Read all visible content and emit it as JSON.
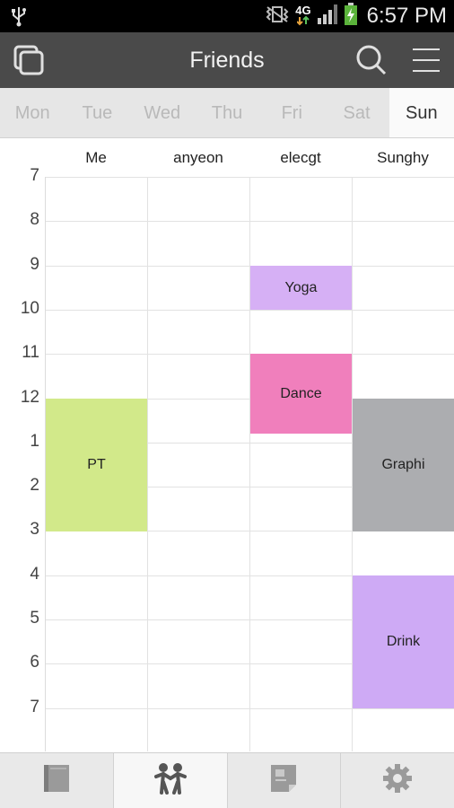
{
  "status_bar": {
    "time": "6:57 PM",
    "network": "4G",
    "icons": [
      "usb-icon",
      "vibrate-icon",
      "network-4g-icon",
      "signal-icon",
      "battery-charging-icon"
    ]
  },
  "action_bar": {
    "title": "Friends",
    "icons": [
      "copy-icon",
      "search-icon",
      "menu-icon"
    ]
  },
  "days": [
    "Mon",
    "Tue",
    "Wed",
    "Thu",
    "Fri",
    "Sat",
    "Sun"
  ],
  "active_day": "Sun",
  "people": [
    "Me",
    "anyeon",
    "elecgt",
    "Sunghy"
  ],
  "hours": [
    "7",
    "8",
    "9",
    "10",
    "11",
    "12",
    "1",
    "2",
    "3",
    "4",
    "5",
    "6",
    "7"
  ],
  "events": [
    {
      "label": "Yoga",
      "person": 2,
      "start": 2,
      "end": 3,
      "color": "#d6b0f5"
    },
    {
      "label": "Dance",
      "person": 2,
      "start": 4,
      "end": 5.8,
      "color": "#f07fbc"
    },
    {
      "label": "PT",
      "person": 0,
      "start": 5,
      "end": 8,
      "color": "#d2e98a"
    },
    {
      "label": "Graphi",
      "person": 3,
      "start": 5,
      "end": 8,
      "color": "#acadb0"
    },
    {
      "label": "Drink",
      "person": 3,
      "start": 9,
      "end": 12,
      "color": "#ceaaf5"
    }
  ],
  "bottom_tabs": [
    {
      "icon": "timetable-icon",
      "active": false
    },
    {
      "icon": "friends-icon",
      "active": true
    },
    {
      "icon": "notes-icon",
      "active": false
    },
    {
      "icon": "settings-icon",
      "active": false
    }
  ]
}
